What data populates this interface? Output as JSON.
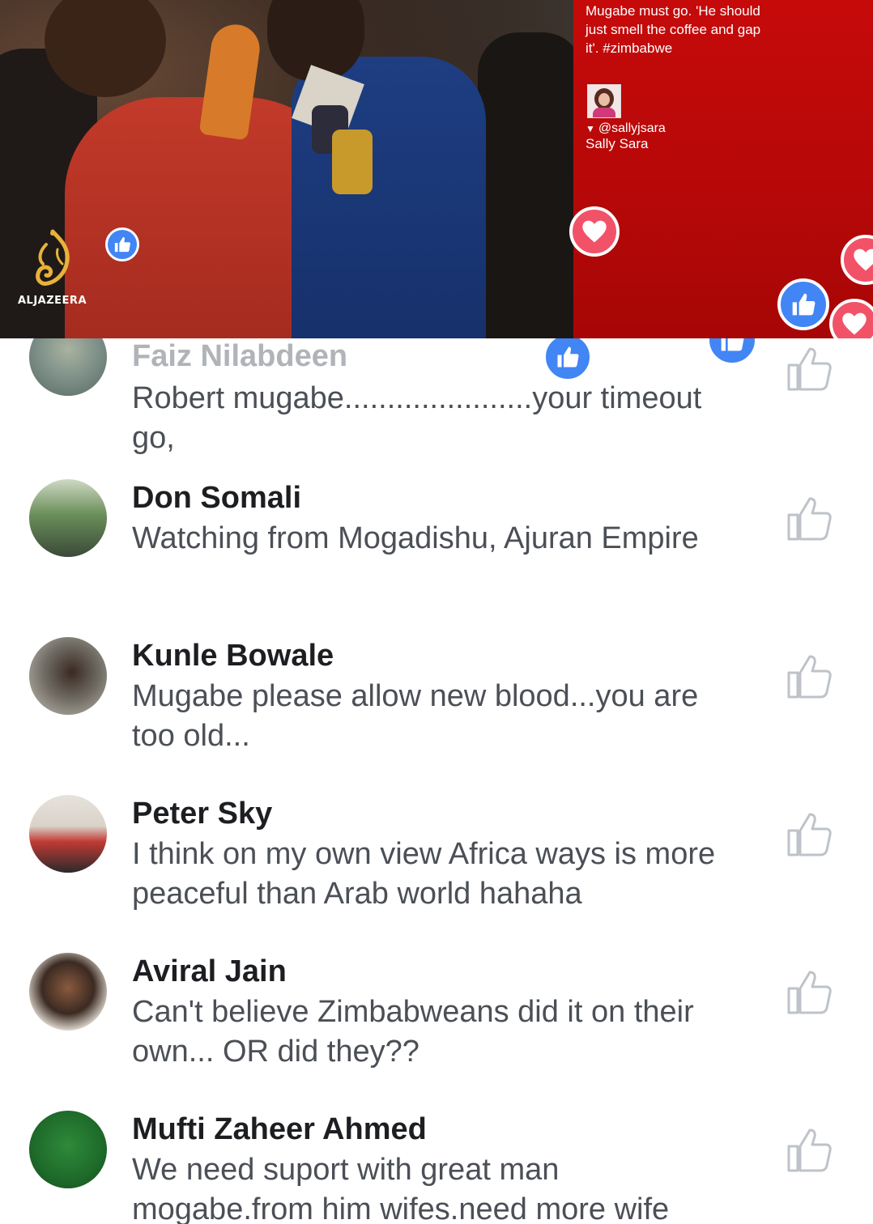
{
  "video": {
    "tweet": {
      "text": "Mugabe must go.  'He should just smell the coffee and gap it'. #zimbabwe",
      "handle": "@sallyjsara",
      "name": "Sally Sara"
    },
    "channel_logo_text": "ALJAZEERA",
    "reactions": [
      "like-icon",
      "love-icon"
    ]
  },
  "colors": {
    "tweet_bg": "#c60a0a",
    "like_blue": "#4285f4",
    "love_red": "#f25268",
    "name_text": "#1c1e21",
    "comment_text": "#4b4f56",
    "like_outline": "#bec3c9"
  },
  "comments": [
    {
      "name": "Faiz Nilabdeen",
      "text": "Robert mugabe......................your timeout go,"
    },
    {
      "name": "Don Somali",
      "text": "Watching from Mogadishu, Ajuran Empire"
    },
    {
      "name": "Kunle Bowale",
      "text": "Mugabe please allow new blood...you are too old..."
    },
    {
      "name": "Peter Sky",
      "text": "I think on my own view Africa ways is more peaceful than Arab world hahaha"
    },
    {
      "name": "Aviral Jain",
      "text": "Can't believe Zimbabweans did  it on their own... OR did they??"
    },
    {
      "name": "Mufti Zaheer Ahmed",
      "text": "We need suport with great man mogabe.from him wifes.need more wife"
    }
  ]
}
